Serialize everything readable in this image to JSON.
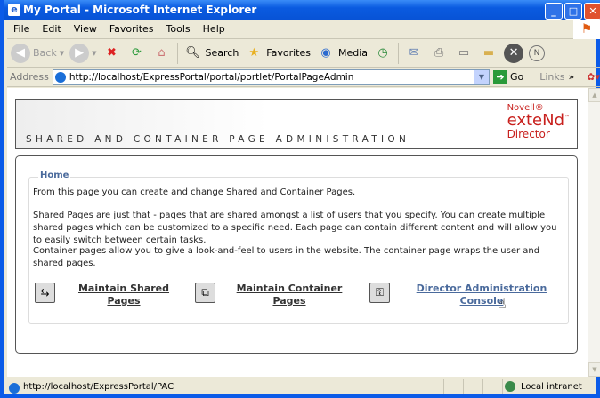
{
  "window": {
    "title": "My Portal - Microsoft Internet Explorer",
    "minimize": "_",
    "maximize": "□",
    "close": "✕"
  },
  "menu": [
    "File",
    "Edit",
    "View",
    "Favorites",
    "Tools",
    "Help"
  ],
  "toolbar": {
    "back": "Back",
    "search": "Search",
    "favorites": "Favorites",
    "media": "Media"
  },
  "address": {
    "label": "Address",
    "url": "http://localhost/ExpressPortal/portal/portlet/PortalPageAdmin",
    "go": "Go",
    "links": "Links",
    "chevron": "»"
  },
  "banner": {
    "heading": "SHARED AND CONTAINER PAGE ADMINISTRATION",
    "logo": {
      "line1": "Novell®",
      "line2": "exteNd™",
      "line3": "Director"
    }
  },
  "home": {
    "legend": "Home",
    "paragraphs": [
      "From this page you can create and change Shared and Container Pages.",
      "Shared Pages are just that - pages that are shared amongst a list of users that you specify. You can create multiple shared pages which can be customized to a specific need. Each page can contain different content and will allow you to easily switch between certain tasks.",
      "Container pages allow you to give a look-and-feel to users in the website. The container page wraps the user and shared pages."
    ],
    "links": [
      {
        "line1": "Maintain Shared",
        "line2": "Pages",
        "icon": "shared-pages-icon"
      },
      {
        "line1": "Maintain Container",
        "line2": "Pages",
        "icon": "container-pages-icon"
      },
      {
        "line1": "Director Administration",
        "line2": "Console",
        "icon": "admin-console-icon"
      }
    ]
  },
  "colors": {
    "visited_link": "#4a6a9c",
    "logo": "#c8201d"
  },
  "status": {
    "text": "http://localhost/ExpressPortal/PAC",
    "zone": "Local intranet"
  }
}
